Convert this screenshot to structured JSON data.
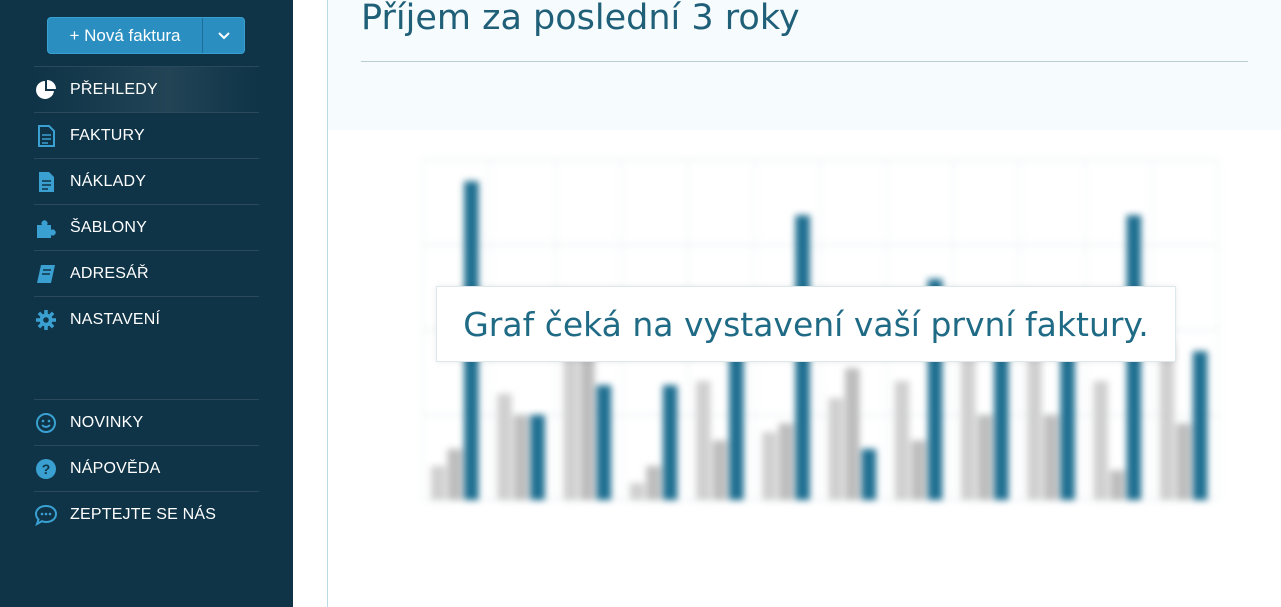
{
  "sidebar": {
    "new_invoice": {
      "label": "+ Nová faktura"
    },
    "items": [
      {
        "key": "prehledy",
        "label": "PŘEHLEDY",
        "icon": "pie-chart-icon",
        "active": true
      },
      {
        "key": "faktury",
        "label": "FAKTURY",
        "icon": "document-icon"
      },
      {
        "key": "naklady",
        "label": "NÁKLADY",
        "icon": "file-icon"
      },
      {
        "key": "sablony",
        "label": "ŠABLONY",
        "icon": "puzzle-icon"
      },
      {
        "key": "adresar",
        "label": "ADRESÁŘ",
        "icon": "address-book-icon"
      },
      {
        "key": "nastaveni",
        "label": "NASTAVENÍ",
        "icon": "gear-icon"
      }
    ],
    "bottom_items": [
      {
        "key": "novinky",
        "label": "NOVINKY",
        "icon": "smiley-icon"
      },
      {
        "key": "napoveda",
        "label": "NÁPOVĚDA",
        "icon": "question-icon"
      },
      {
        "key": "zeptejte",
        "label": "ZEPTEJTE SE NÁS",
        "icon": "chat-icon"
      }
    ]
  },
  "main": {
    "title": "Příjem za poslední 3 roky",
    "overlay_text": "Graf čeká na vystavení vaší první faktury."
  },
  "colors": {
    "sidebar_bg": "#0f3447",
    "accent": "#2a8ec1",
    "title": "#1f5f78",
    "series_dark": "#1f6f91",
    "series_mid": "#5d9bb8",
    "series_light": "#d0d0d0"
  },
  "chart_data": {
    "type": "bar",
    "categories": [
      "",
      "",
      "",
      "",
      "",
      "",
      "",
      "",
      "",
      "",
      "",
      ""
    ],
    "ylim": [
      0,
      800
    ],
    "series": [
      {
        "values": [
          80,
          250,
          400,
          40,
          280,
          160,
          240,
          280,
          400,
          340,
          280,
          370
        ]
      },
      {
        "values": [
          120,
          200,
          350,
          80,
          140,
          180,
          310,
          140,
          200,
          200,
          70,
          180
        ]
      },
      {
        "values": [
          750,
          200,
          270,
          270,
          400,
          670,
          120,
          520,
          380,
          430,
          670,
          350
        ]
      }
    ]
  }
}
